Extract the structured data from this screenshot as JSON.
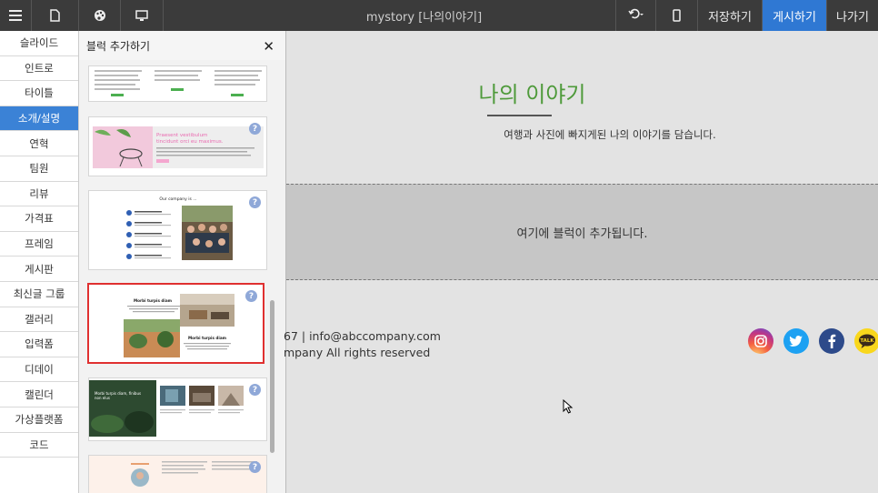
{
  "topbar": {
    "menu_icon": "hamburger-menu-icon",
    "title": "mystory [나의이야기]",
    "undo_icon": "undo-icon",
    "save_label": "저장하기",
    "publish_label": "게시하기",
    "exit_label": "나가기",
    "accent": "#2f78d3"
  },
  "sidebar": {
    "items": [
      {
        "label": "슬라이드"
      },
      {
        "label": "인트로"
      },
      {
        "label": "타이틀"
      },
      {
        "label": "소개/설명",
        "active": true
      },
      {
        "label": "연혁"
      },
      {
        "label": "팀원"
      },
      {
        "label": "리뷰"
      },
      {
        "label": "가격표"
      },
      {
        "label": "프레임"
      },
      {
        "label": "게시판"
      },
      {
        "label": "최신글 그룹"
      },
      {
        "label": "갤러리"
      },
      {
        "label": "입력폼"
      },
      {
        "label": "디데이"
      },
      {
        "label": "캘린더"
      },
      {
        "label": "가상플랫폼"
      },
      {
        "label": "코드"
      }
    ]
  },
  "panel": {
    "title": "블럭 추가하기",
    "help": "?",
    "thumb2": {
      "heading": "Praesent vestibulum tincidunt orci eu maximus."
    },
    "thumb3": {
      "heading": "Our company is ..."
    },
    "thumb4": {
      "heading_a": "Morbi turpis diam",
      "heading_b": "Morbi turpis diam"
    },
    "thumb5": {
      "heading": "Morbi turpis diam, finibus non elus"
    }
  },
  "canvas": {
    "title": "나의 이야기",
    "subtitle": "여행과 사진에 빠지게된 나의 이야기를 담습니다.",
    "drop_hint": "여기에 블럭이 추가됩니다.",
    "footer_line1": "67 | info@abccompany.com",
    "footer_line2": "mpany All rights reserved",
    "social": [
      "instagram-icon",
      "twitter-icon",
      "facebook-icon",
      "kakaotalk-icon"
    ],
    "kakao_label": "TALK",
    "title_color": "#4e9a3a"
  }
}
